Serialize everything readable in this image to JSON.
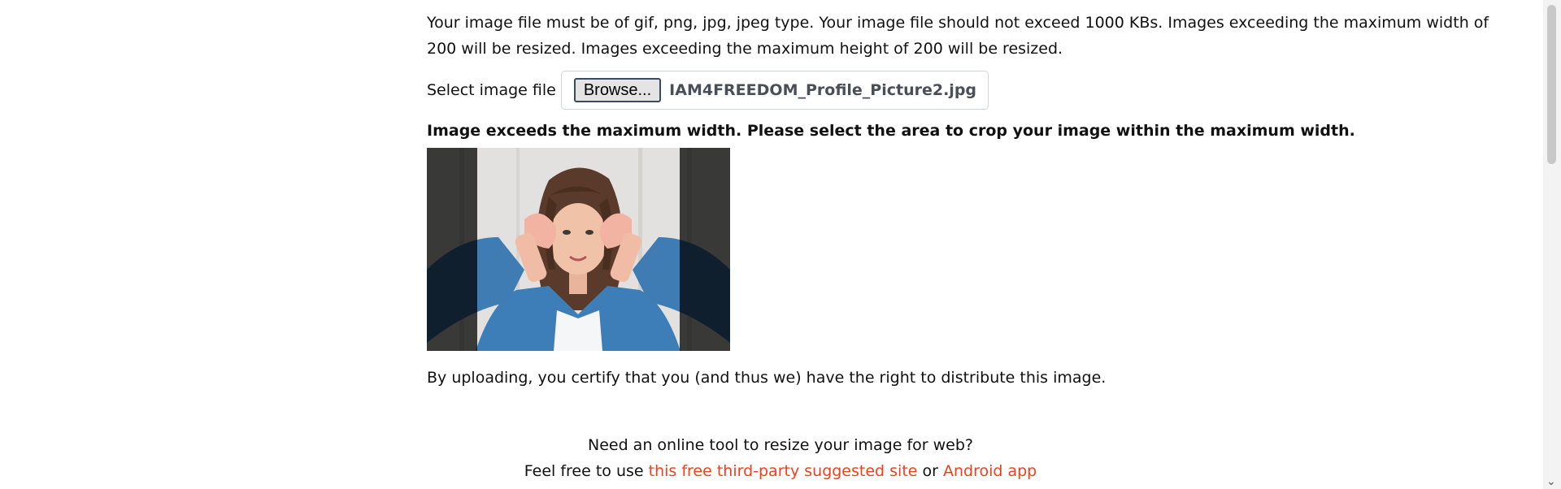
{
  "upload": {
    "requirements_text": "Your image file must be of gif, png, jpg, jpeg type. Your image file should not exceed 1000 KBs. Images exceeding the maximum width of 200 will be resized. Images exceeding the maximum height of 200 will be resized.",
    "select_label": "Select image file",
    "browse_label": "Browse...",
    "file_name": "IAM4FREEDOM_Profile_Picture2.jpg",
    "crop_warning": "Image exceeds the maximum width. Please select the area to crop your image within the maximum width.",
    "certify_text": "By uploading, you certify that you (and thus we) have the right to distribute this image."
  },
  "footer": {
    "line1": "Need an online tool to resize your image for web?",
    "line2_prefix": "Feel free to use ",
    "link_site": "this free third-party suggested site",
    "or_text": " or ",
    "link_app": "Android app"
  },
  "colors": {
    "link": "#f0411f",
    "crop_mask": "#000000bf"
  },
  "icons": {
    "scroll_down": "chevron-down-icon"
  }
}
